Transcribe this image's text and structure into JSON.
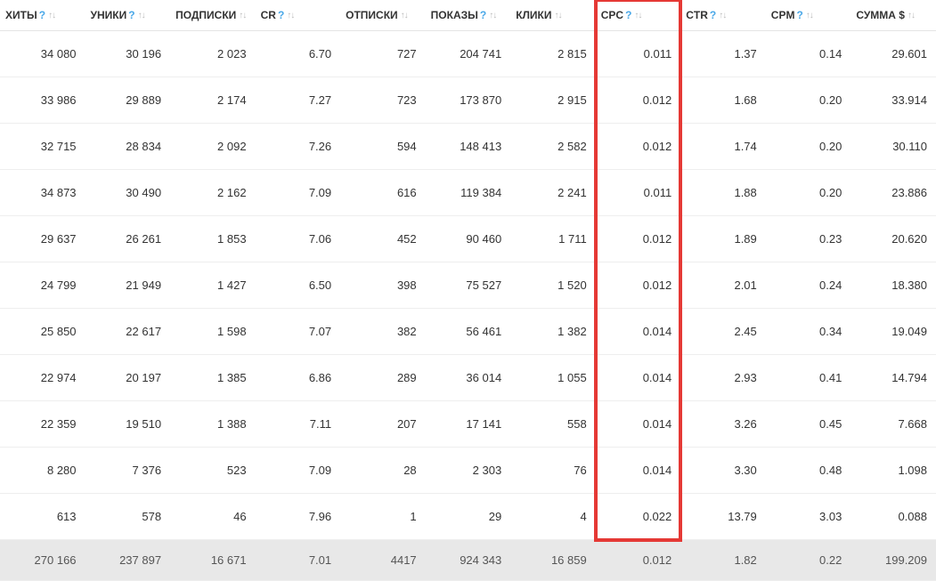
{
  "columns": [
    {
      "label": "ХИТЫ",
      "help": true
    },
    {
      "label": "УНИКИ",
      "help": true
    },
    {
      "label": "ПОДПИСКИ",
      "help": false
    },
    {
      "label": "CR",
      "help": true
    },
    {
      "label": "ОТПИСКИ",
      "help": false
    },
    {
      "label": "ПОКАЗЫ",
      "help": true
    },
    {
      "label": "КЛИКИ",
      "help": false
    },
    {
      "label": "CPC",
      "help": true,
      "highlight": true
    },
    {
      "label": "CTR",
      "help": true
    },
    {
      "label": "CPM",
      "help": true
    },
    {
      "label": "СУММА $",
      "help": false
    }
  ],
  "help_symbol": "?",
  "rows": [
    [
      "34 080",
      "30 196",
      "2 023",
      "6.70",
      "727",
      "204 741",
      "2 815",
      "0.011",
      "1.37",
      "0.14",
      "29.601"
    ],
    [
      "33 986",
      "29 889",
      "2 174",
      "7.27",
      "723",
      "173 870",
      "2 915",
      "0.012",
      "1.68",
      "0.20",
      "33.914"
    ],
    [
      "32 715",
      "28 834",
      "2 092",
      "7.26",
      "594",
      "148 413",
      "2 582",
      "0.012",
      "1.74",
      "0.20",
      "30.110"
    ],
    [
      "34 873",
      "30 490",
      "2 162",
      "7.09",
      "616",
      "119 384",
      "2 241",
      "0.011",
      "1.88",
      "0.20",
      "23.886"
    ],
    [
      "29 637",
      "26 261",
      "1 853",
      "7.06",
      "452",
      "90 460",
      "1 711",
      "0.012",
      "1.89",
      "0.23",
      "20.620"
    ],
    [
      "24 799",
      "21 949",
      "1 427",
      "6.50",
      "398",
      "75 527",
      "1 520",
      "0.012",
      "2.01",
      "0.24",
      "18.380"
    ],
    [
      "25 850",
      "22 617",
      "1 598",
      "7.07",
      "382",
      "56 461",
      "1 382",
      "0.014",
      "2.45",
      "0.34",
      "19.049"
    ],
    [
      "22 974",
      "20 197",
      "1 385",
      "6.86",
      "289",
      "36 014",
      "1 055",
      "0.014",
      "2.93",
      "0.41",
      "14.794"
    ],
    [
      "22 359",
      "19 510",
      "1 388",
      "7.11",
      "207",
      "17 141",
      "558",
      "0.014",
      "3.26",
      "0.45",
      "7.668"
    ],
    [
      "8 280",
      "7 376",
      "523",
      "7.09",
      "28",
      "2 303",
      "76",
      "0.014",
      "3.30",
      "0.48",
      "1.098"
    ],
    [
      "613",
      "578",
      "46",
      "7.96",
      "1",
      "29",
      "4",
      "0.022",
      "13.79",
      "3.03",
      "0.088"
    ]
  ],
  "totals": [
    "270 166",
    "237 897",
    "16 671",
    "7.01",
    "4417",
    "924 343",
    "16 859",
    "0.012",
    "1.82",
    "0.22",
    "199.209"
  ]
}
